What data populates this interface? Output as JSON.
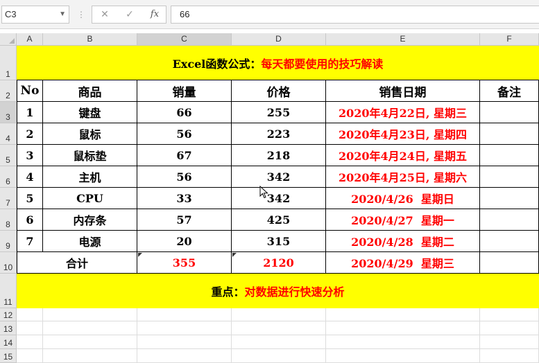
{
  "formula_bar": {
    "name_box": "C3",
    "formula_value": "66",
    "cancel_glyph": "✕",
    "enter_glyph": "✓",
    "fx_label": "fx"
  },
  "columns": [
    "A",
    "B",
    "C",
    "D",
    "E",
    "F"
  ],
  "rows": [
    "1",
    "2",
    "3",
    "4",
    "5",
    "6",
    "7",
    "8",
    "9",
    "10",
    "11",
    "12",
    "13",
    "14",
    "15"
  ],
  "sheet": {
    "title_black": "Excel函数公式：",
    "title_red": "每天都要使用的技巧解读",
    "headers": [
      "No",
      "商品",
      "销量",
      "价格",
      "销售日期",
      "备注"
    ],
    "data": [
      {
        "no": "1",
        "item": "键盘",
        "qty": "66",
        "price": "255",
        "date": "2020年4月22日, 星期三",
        "note": ""
      },
      {
        "no": "2",
        "item": "鼠标",
        "qty": "56",
        "price": "223",
        "date": "2020年4月23日, 星期四",
        "note": ""
      },
      {
        "no": "3",
        "item": "鼠标垫",
        "qty": "67",
        "price": "218",
        "date": "2020年4月24日, 星期五",
        "note": ""
      },
      {
        "no": "4",
        "item": "主机",
        "qty": "56",
        "price": "342",
        "date": "2020年4月25日, 星期六",
        "note": ""
      },
      {
        "no": "5",
        "item": "CPU",
        "qty": "33",
        "price": "342",
        "date": "2020/4/26  星期日",
        "note": ""
      },
      {
        "no": "6",
        "item": "内存条",
        "qty": "57",
        "price": "425",
        "date": "2020/4/27  星期一",
        "note": ""
      },
      {
        "no": "7",
        "item": "电源",
        "qty": "20",
        "price": "315",
        "date": "2020/4/28  星期二",
        "note": ""
      }
    ],
    "total": {
      "label": "合计",
      "qty": "355",
      "price": "2120",
      "date": "2020/4/29  星期三"
    },
    "footer_black": "重点：",
    "footer_red": "对数据进行快速分析"
  },
  "colors": {
    "highlight": "#ffff00",
    "accent_red": "#ff0000",
    "selection_green": "#217346"
  },
  "selected_cell": "C3"
}
